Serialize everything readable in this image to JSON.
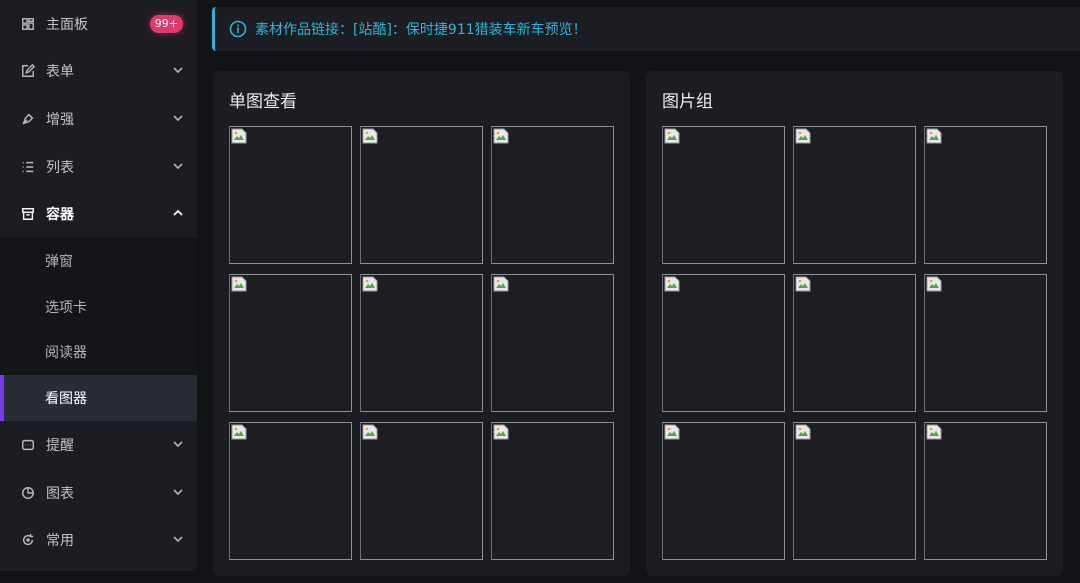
{
  "sidebar": {
    "items": [
      {
        "label": "主面板",
        "icon": "dashboard-icon",
        "badge": "99+"
      },
      {
        "label": "表单",
        "icon": "edit-icon"
      },
      {
        "label": "增强",
        "icon": "pen-icon"
      },
      {
        "label": "列表",
        "icon": "list-icon"
      },
      {
        "label": "容器",
        "icon": "archive-icon"
      },
      {
        "label": "提醒",
        "icon": "message-icon"
      },
      {
        "label": "图表",
        "icon": "pie-chart-icon"
      },
      {
        "label": "常用",
        "icon": "refresh-icon"
      }
    ],
    "submenu": [
      {
        "label": "弹窗"
      },
      {
        "label": "选项卡"
      },
      {
        "label": "阅读器"
      },
      {
        "label": "看图器",
        "active": true
      }
    ]
  },
  "alert": {
    "text": "素材作品链接：[站酷]：保时捷911猎装车新车预览！",
    "color": "#29b6d8"
  },
  "cards": [
    {
      "title": "单图查看"
    },
    {
      "title": "图片组"
    }
  ],
  "accent": "#7c3aed",
  "badge_color": "#e2386e"
}
